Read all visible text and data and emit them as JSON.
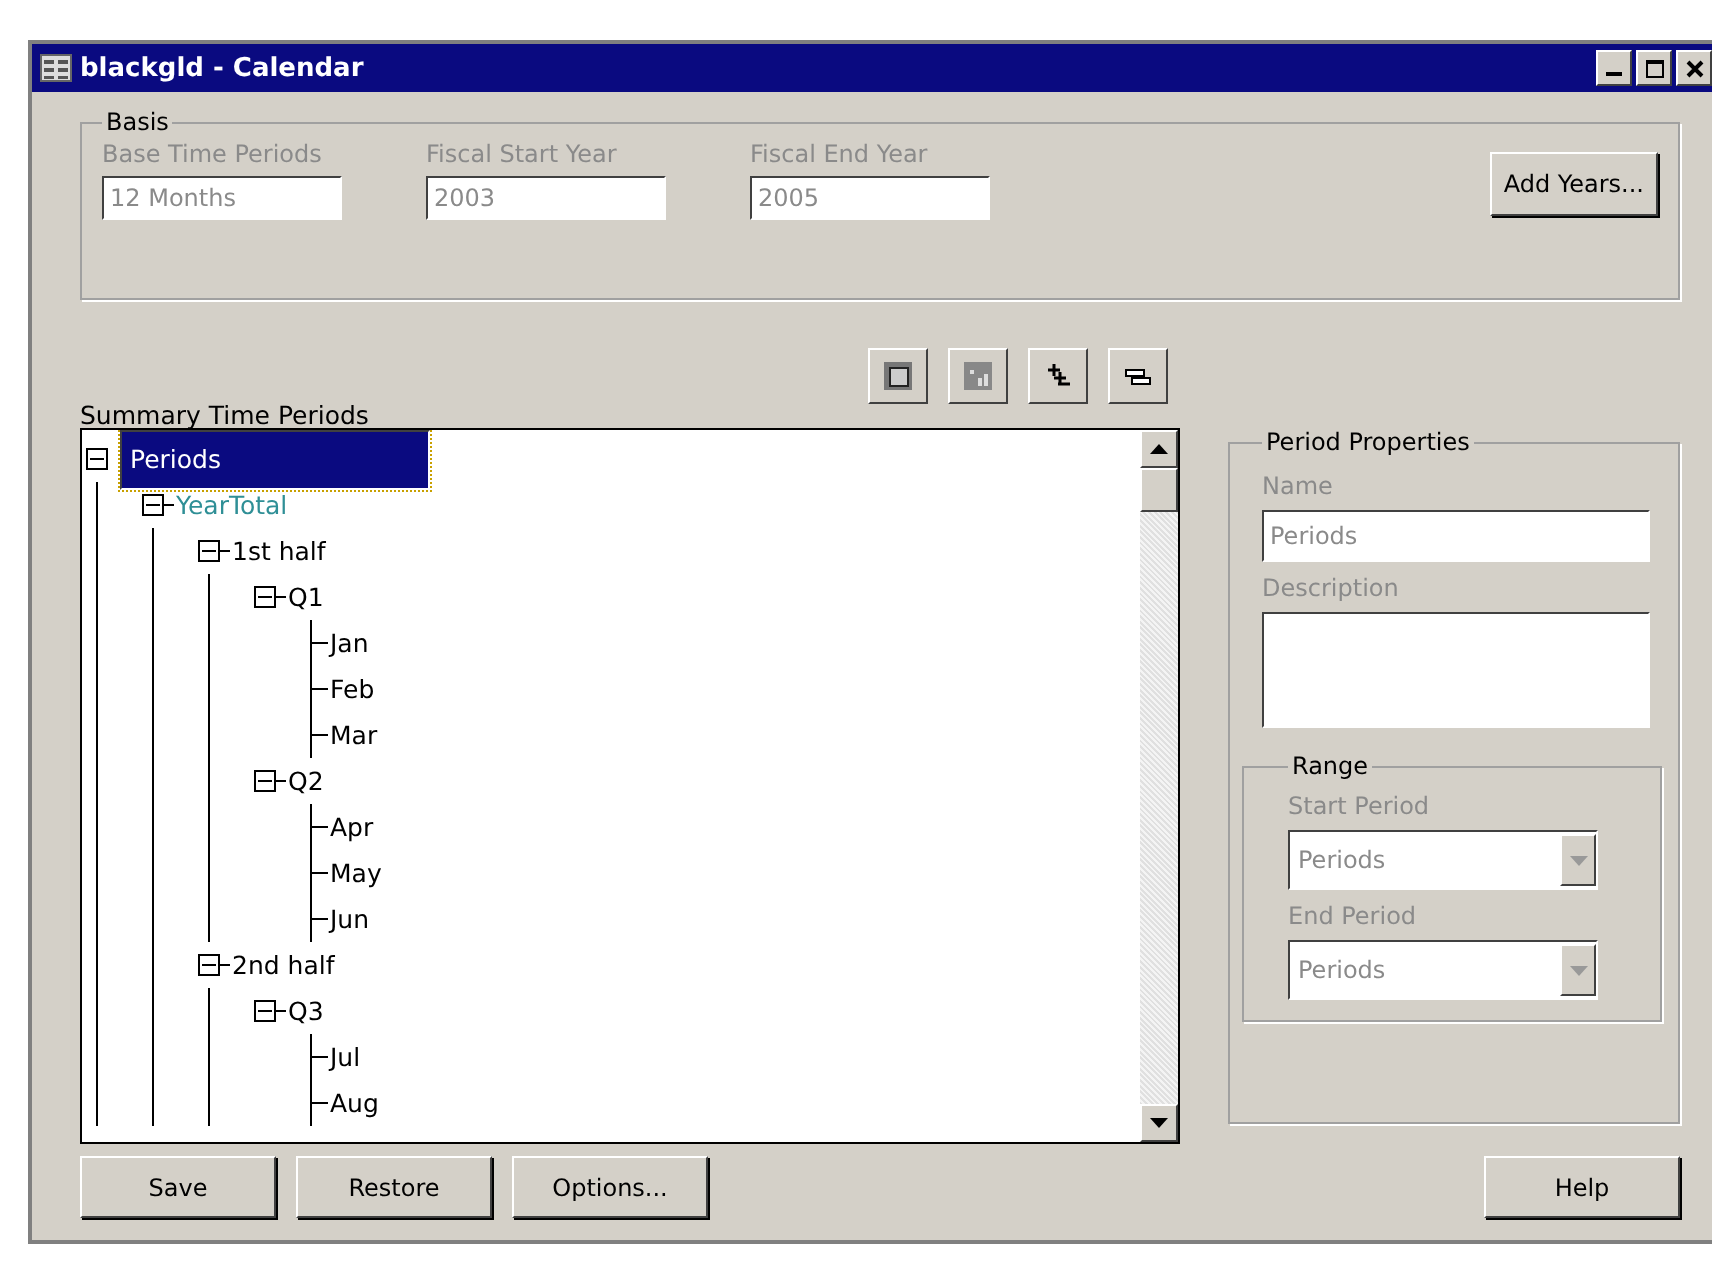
{
  "window": {
    "title": "blackgld - Calendar"
  },
  "basis": {
    "title": "Basis",
    "fields": [
      {
        "label": "Base Time Periods",
        "value": "12 Months",
        "disabled": true
      },
      {
        "label": "Fiscal Start Year",
        "value": "2003",
        "disabled": true
      },
      {
        "label": "Fiscal End Year",
        "value": "2005",
        "disabled": true
      }
    ],
    "add_button": "Add Years..."
  },
  "summary": {
    "title": "Summary Time Periods",
    "tree": [
      {
        "label": "Periods",
        "selected": true,
        "expanded": true,
        "children": [
          {
            "label": "YearTotal",
            "selected": false,
            "expanded": true,
            "color": "#2f8f96",
            "children": [
              {
                "label": "1st half",
                "selected": false,
                "expanded": true,
                "children": [
                  {
                    "label": "Q1",
                    "selected": false,
                    "expanded": true,
                    "children": [
                      {
                        "label": "Jan",
                        "selected": false
                      },
                      {
                        "label": "Feb",
                        "selected": false
                      },
                      {
                        "label": "Mar",
                        "selected": false
                      }
                    ]
                  },
                  {
                    "label": "Q2",
                    "selected": false,
                    "expanded": true,
                    "children": [
                      {
                        "label": "Apr",
                        "selected": false
                      },
                      {
                        "label": "May",
                        "selected": false
                      },
                      {
                        "label": "Jun",
                        "selected": false
                      }
                    ]
                  }
                ]
              },
              {
                "label": "2nd half",
                "selected": false,
                "expanded": true,
                "children": [
                  {
                    "label": "Q3",
                    "selected": false,
                    "expanded": true,
                    "children": [
                      {
                        "label": "Jul",
                        "selected": false
                      },
                      {
                        "label": "Aug",
                        "selected": false
                      }
                    ]
                  }
                ]
              }
            ]
          }
        ]
      }
    ]
  },
  "properties": {
    "title": "Period Properties",
    "name_label": "Name",
    "name_value": "Periods",
    "description_label": "Description",
    "range": {
      "title": "Range",
      "start_label": "Start Period",
      "start_value": "Periods",
      "end_label": "End Period",
      "end_value": "Periods",
      "disabled": true
    }
  },
  "buttons": [
    "Save",
    "Restore",
    "Options..."
  ],
  "help_button": "Help"
}
